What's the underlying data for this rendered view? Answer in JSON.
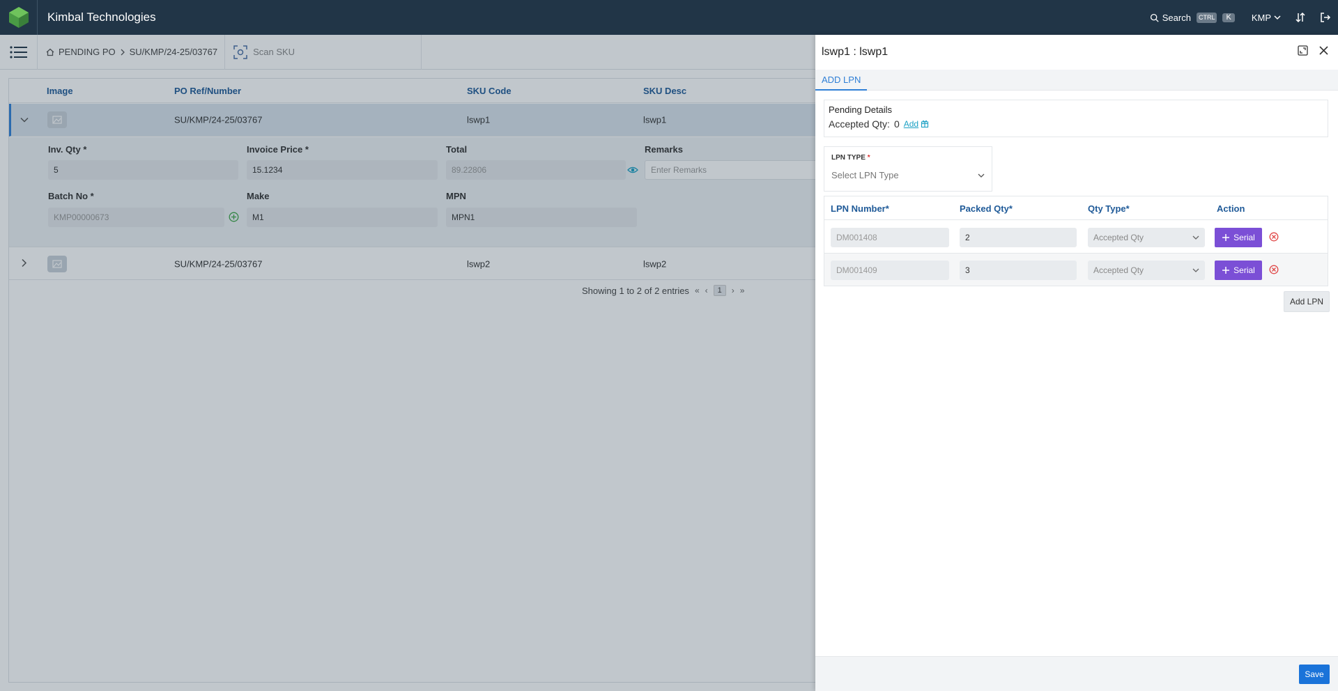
{
  "app": {
    "brand": "Kimbal Technologies",
    "search_label": "Search",
    "kbd_ctrl": "CTRL",
    "kbd_k": "K",
    "tenant": "KMP"
  },
  "breadcrumb": {
    "home": "PENDING PO",
    "current": "SU/KMP/24-25/03767"
  },
  "scan_label": "Scan SKU",
  "table": {
    "headers": [
      "Image",
      "PO Ref/Number",
      "SKU Code",
      "SKU Desc"
    ],
    "rows": [
      {
        "po_ref": "SU/KMP/24-25/03767",
        "sku_code": "lswp1",
        "sku_desc": "lswp1"
      },
      {
        "po_ref": "SU/KMP/24-25/03767",
        "sku_code": "lswp2",
        "sku_desc": "lswp2"
      }
    ],
    "detail": {
      "inv_qty_label": "Inv. Qty *",
      "inv_qty": "5",
      "invoice_price_label": "Invoice Price *",
      "invoice_price": "15.1234",
      "total_label": "Total",
      "total": "89.22806",
      "remarks_label": "Remarks",
      "remarks_placeholder": "Enter Remarks",
      "batch_label": "Batch No *",
      "batch": "KMP00000673",
      "make_label": "Make",
      "make": "M1",
      "mpn_label": "MPN",
      "mpn": "MPN1"
    },
    "pagination": {
      "summary": "Showing 1 to 2 of 2 entries",
      "page": "1"
    }
  },
  "drawer": {
    "title": "lswp1 : lswp1",
    "tab": "ADD LPN",
    "pending_title": "Pending Details",
    "accepted_label": "Accepted Qty:",
    "accepted_value": "0",
    "add_link": "Add",
    "lpn_type_label": "LPN TYPE",
    "lpn_type_required": "*",
    "lpn_type_placeholder": "Select LPN Type",
    "grid_headers": [
      "LPN Number*",
      "Packed Qty*",
      "Qty Type*",
      "Action"
    ],
    "lpn_rows": [
      {
        "lpn": "DM001408",
        "packed": "2",
        "qty_type": "Accepted Qty",
        "serial": "Serial"
      },
      {
        "lpn": "DM001409",
        "packed": "3",
        "qty_type": "Accepted Qty",
        "serial": "Serial"
      }
    ],
    "add_lpn": "Add LPN",
    "save": "Save"
  },
  "colors": {
    "topbar": "#213547",
    "accent": "#2f7fd6",
    "serial_button": "#7b4fd6",
    "save_button": "#1a73d9",
    "logo_green": "#5cb85c"
  }
}
